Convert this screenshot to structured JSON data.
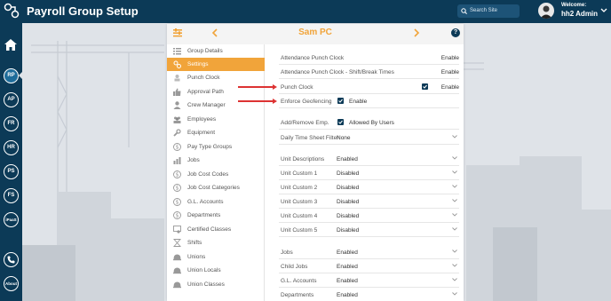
{
  "header": {
    "title": "Payroll Group Setup",
    "search_placeholder": "Search Site",
    "welcome": "Welcome:",
    "username": "hh2 Admin"
  },
  "rail": {
    "items": [
      {
        "label": "RP",
        "active": true
      },
      {
        "label": "AP"
      },
      {
        "label": "FR"
      },
      {
        "label": "HR"
      },
      {
        "label": "PS"
      },
      {
        "label": "FS"
      },
      {
        "label": "iPaaS"
      },
      {
        "label": "About"
      }
    ]
  },
  "panel": {
    "employee_name": "Sam PC",
    "menu": [
      {
        "label": "Group Details",
        "icon": "list-icon"
      },
      {
        "label": "Settings",
        "icon": "settings-icon",
        "active": true
      },
      {
        "label": "Punch Clock",
        "icon": "punch-clock-icon"
      },
      {
        "label": "Approval Path",
        "icon": "thumbs-up-icon"
      },
      {
        "label": "Crew Manager",
        "icon": "user-icon"
      },
      {
        "label": "Employees",
        "icon": "users-icon"
      },
      {
        "label": "Equipment",
        "icon": "wrench-icon"
      },
      {
        "label": "Pay Type Groups",
        "icon": "dollar-icon"
      },
      {
        "label": "Jobs",
        "icon": "chart-icon"
      },
      {
        "label": "Job Cost Codes",
        "icon": "dollar-icon"
      },
      {
        "label": "Job Cost Categories",
        "icon": "dollar-icon"
      },
      {
        "label": "G.L. Accounts",
        "icon": "dollar-icon"
      },
      {
        "label": "Departments",
        "icon": "dollar-icon"
      },
      {
        "label": "Certified Classes",
        "icon": "certificate-icon"
      },
      {
        "label": "Shifts",
        "icon": "hourglass-icon"
      },
      {
        "label": "Unions",
        "icon": "helmet-icon"
      },
      {
        "label": "Union Locals",
        "icon": "helmet-icon"
      },
      {
        "label": "Union Classes",
        "icon": "helmet-icon"
      }
    ],
    "settings": {
      "attendance_punch_clock": {
        "label": "Attendance Punch Clock",
        "value": "Enable"
      },
      "attendance_shift_break": {
        "label": "Attendance Punch Clock - Shift/Break Times",
        "value": "Enable"
      },
      "punch_clock": {
        "label": "Punch Clock",
        "value": "Enable"
      },
      "enforce_geofencing": {
        "label": "Enforce Geofencing",
        "value": "Enable"
      },
      "add_remove_emp": {
        "label": "Add/Remove Emp.",
        "value": "Allowed By Users"
      },
      "daily_time_sheet_filter": {
        "label": "Daily Time Sheet Filter",
        "value": "None"
      },
      "dropdowns": [
        {
          "label": "Unit Descriptions",
          "value": "Enabled"
        },
        {
          "label": "Unit Custom 1",
          "value": "Disabled"
        },
        {
          "label": "Unit Custom 2",
          "value": "Disabled"
        },
        {
          "label": "Unit Custom 3",
          "value": "Disabled"
        },
        {
          "label": "Unit Custom 4",
          "value": "Disabled"
        },
        {
          "label": "Unit Custom 5",
          "value": "Disabled"
        }
      ],
      "dropdowns2": [
        {
          "label": "Jobs",
          "value": "Enabled"
        },
        {
          "label": "Child Jobs",
          "value": "Enabled"
        },
        {
          "label": "G.L. Accounts",
          "value": "Enabled"
        },
        {
          "label": "Departments",
          "value": "Enabled"
        }
      ]
    }
  },
  "colors": {
    "navy": "#0c3a57",
    "accent": "#f1a43a",
    "arrow": "#d33333"
  }
}
